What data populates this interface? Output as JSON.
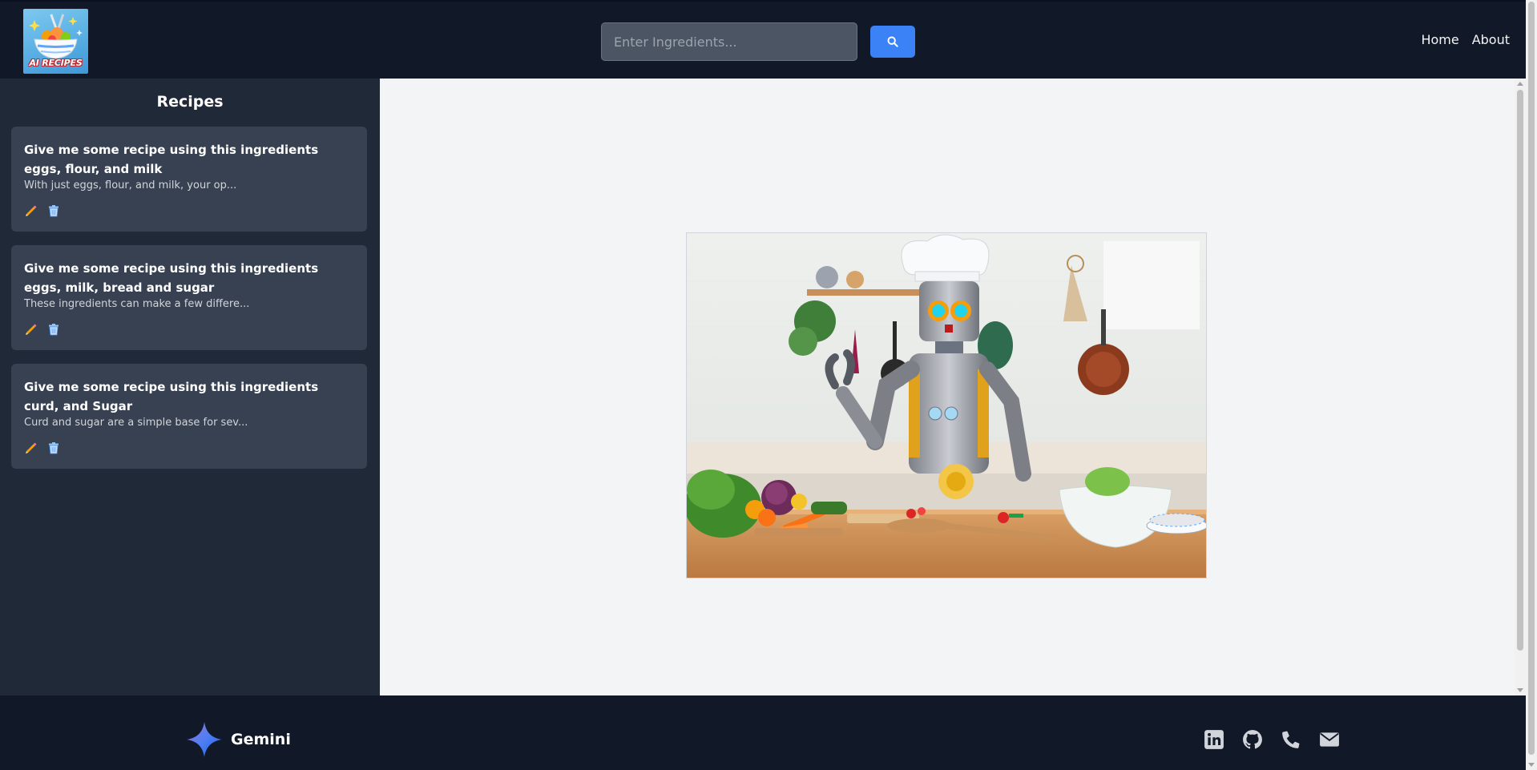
{
  "header": {
    "logo_text": "AI RECIPES",
    "search_placeholder": "Enter Ingredients...",
    "search_icon": "search-icon",
    "nav": [
      {
        "label": "Home"
      },
      {
        "label": "About"
      }
    ]
  },
  "sidebar": {
    "title": "Recipes",
    "items": [
      {
        "title": "Give me some recipe using this ingredients eggs, flour, and milk",
        "snippet": "With just eggs, flour, and milk, your op...",
        "edit_icon": "pencil-icon",
        "delete_icon": "trash-icon"
      },
      {
        "title": "Give me some recipe using this ingredients eggs, milk, bread and sugar",
        "snippet": "These ingredients can make a few differe...",
        "edit_icon": "pencil-icon",
        "delete_icon": "trash-icon"
      },
      {
        "title": "Give me some recipe using this ingredients curd, and Sugar",
        "snippet": "Curd and sugar are a simple base for sev...",
        "edit_icon": "pencil-icon",
        "delete_icon": "trash-icon"
      }
    ]
  },
  "main": {
    "image": "robot-chef-in-kitchen"
  },
  "footer": {
    "brand": "Gemini",
    "social": [
      "linkedin-icon",
      "github-icon",
      "phone-icon",
      "email-icon"
    ]
  },
  "colors": {
    "header_bg": "#111827",
    "sidebar_bg": "#1f2937",
    "card_bg": "#374151",
    "main_bg": "#f3f4f6",
    "accent": "#3b82f6"
  }
}
